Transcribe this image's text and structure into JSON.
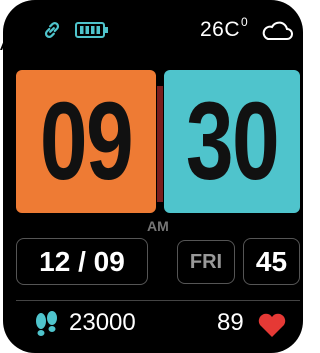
{
  "corner_letter": "A",
  "status": {
    "link_icon": "link-icon",
    "battery_icon": "battery-icon",
    "temperature": "26C",
    "temperature_unit_sup": "0",
    "weather_icon": "cloud-icon"
  },
  "time": {
    "hours": "09",
    "minutes": "30",
    "period": "AM"
  },
  "date": {
    "date_text": "12 / 09",
    "day": "FRI",
    "number": "45"
  },
  "stats": {
    "steps": "23000",
    "steps_icon": "footsteps-icon",
    "heart_rate": "89",
    "heart_icon": "heart-icon"
  },
  "colors": {
    "hour_tile": "#ee7b34",
    "minute_tile": "#4fc4cc",
    "accent_icon": "#4fc4cc",
    "heart": "#e53935",
    "background": "#000000"
  }
}
